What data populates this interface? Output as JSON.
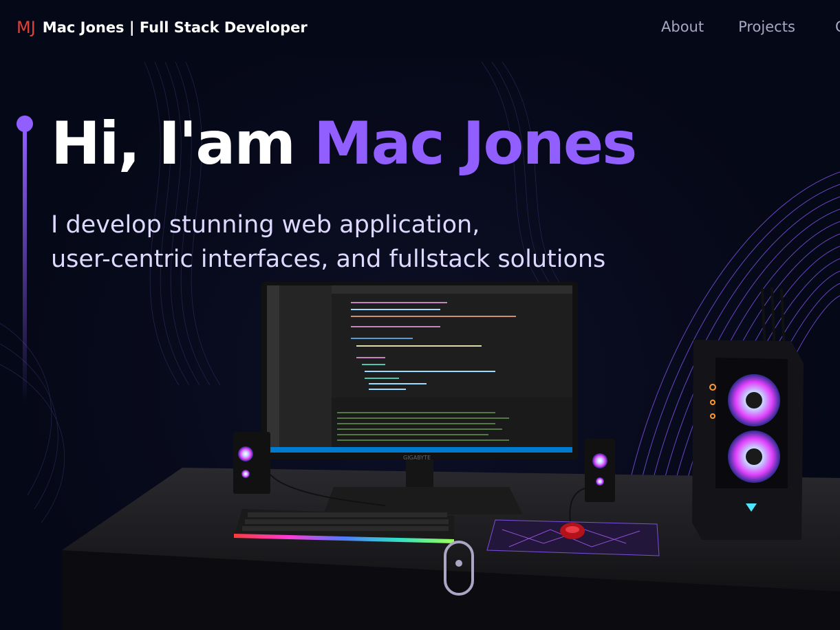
{
  "navbar": {
    "logo_mark": "MJ",
    "logo_text": "Mac Jones | Full Stack Developer",
    "links": [
      "About",
      "Projects",
      "C"
    ]
  },
  "hero": {
    "title_prefix": "Hi, I'am ",
    "title_name": "Mac Jones",
    "subtitle_line1": "I develop stunning web application,",
    "subtitle_line2": "user-centric interfaces, and fullstack solutions"
  },
  "colors": {
    "background": "#050816",
    "accent": "#915eff",
    "logo": "#e0413a",
    "nav_text": "#aaa6c3",
    "subtitle": "#dfd9ff"
  },
  "scene": {
    "monitor_brand": "GIGABYTE"
  }
}
